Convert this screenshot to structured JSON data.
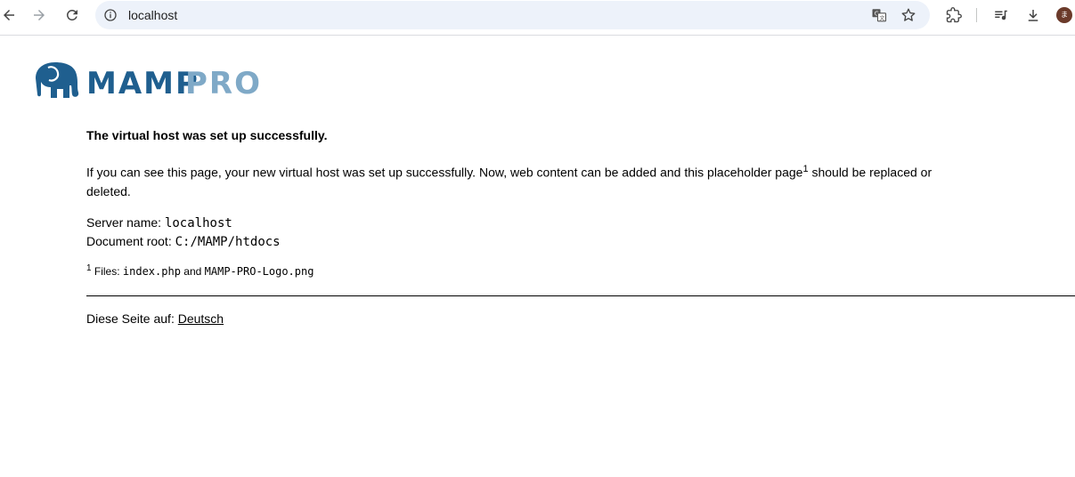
{
  "browser": {
    "url": "localhost",
    "icons": {
      "back": "arrow-left-icon",
      "forward": "arrow-right-icon",
      "reload": "reload-icon",
      "info": "info-icon",
      "translate": "translate-icon",
      "bookmark": "star-icon",
      "extensions": "puzzle-icon",
      "media": "playlist-icon",
      "downloads": "download-icon"
    },
    "avatar_letter": "ま",
    "colors": {
      "omnibox_bg": "#edf2fa",
      "avatar_bg": "#6b3a2a"
    }
  },
  "logo": {
    "mamp": "MAMP",
    "pro": "PRO",
    "colors": {
      "mamp": "#1f5f8f",
      "pro": "#7fa9c7"
    }
  },
  "content": {
    "headline": "The virtual host was set up successfully.",
    "paragraph_part1": "If you can see this page, your new virtual host was set up successfully. Now, web content can be added and this placeholder page",
    "paragraph_sup": "1",
    "paragraph_part2": " should be replaced or deleted.",
    "server_name_label": "Server name: ",
    "server_name_value": "localhost",
    "document_root_label": "Document root: ",
    "document_root_value": "C:/MAMP/htdocs",
    "footnote_sup": "1",
    "footnote_prefix": " Files: ",
    "footnote_file1": "index.php",
    "footnote_and": " and ",
    "footnote_file2": "MAMP-PRO-Logo.png",
    "lang_label": "Diese Seite auf: ",
    "lang_link": "Deutsch"
  }
}
